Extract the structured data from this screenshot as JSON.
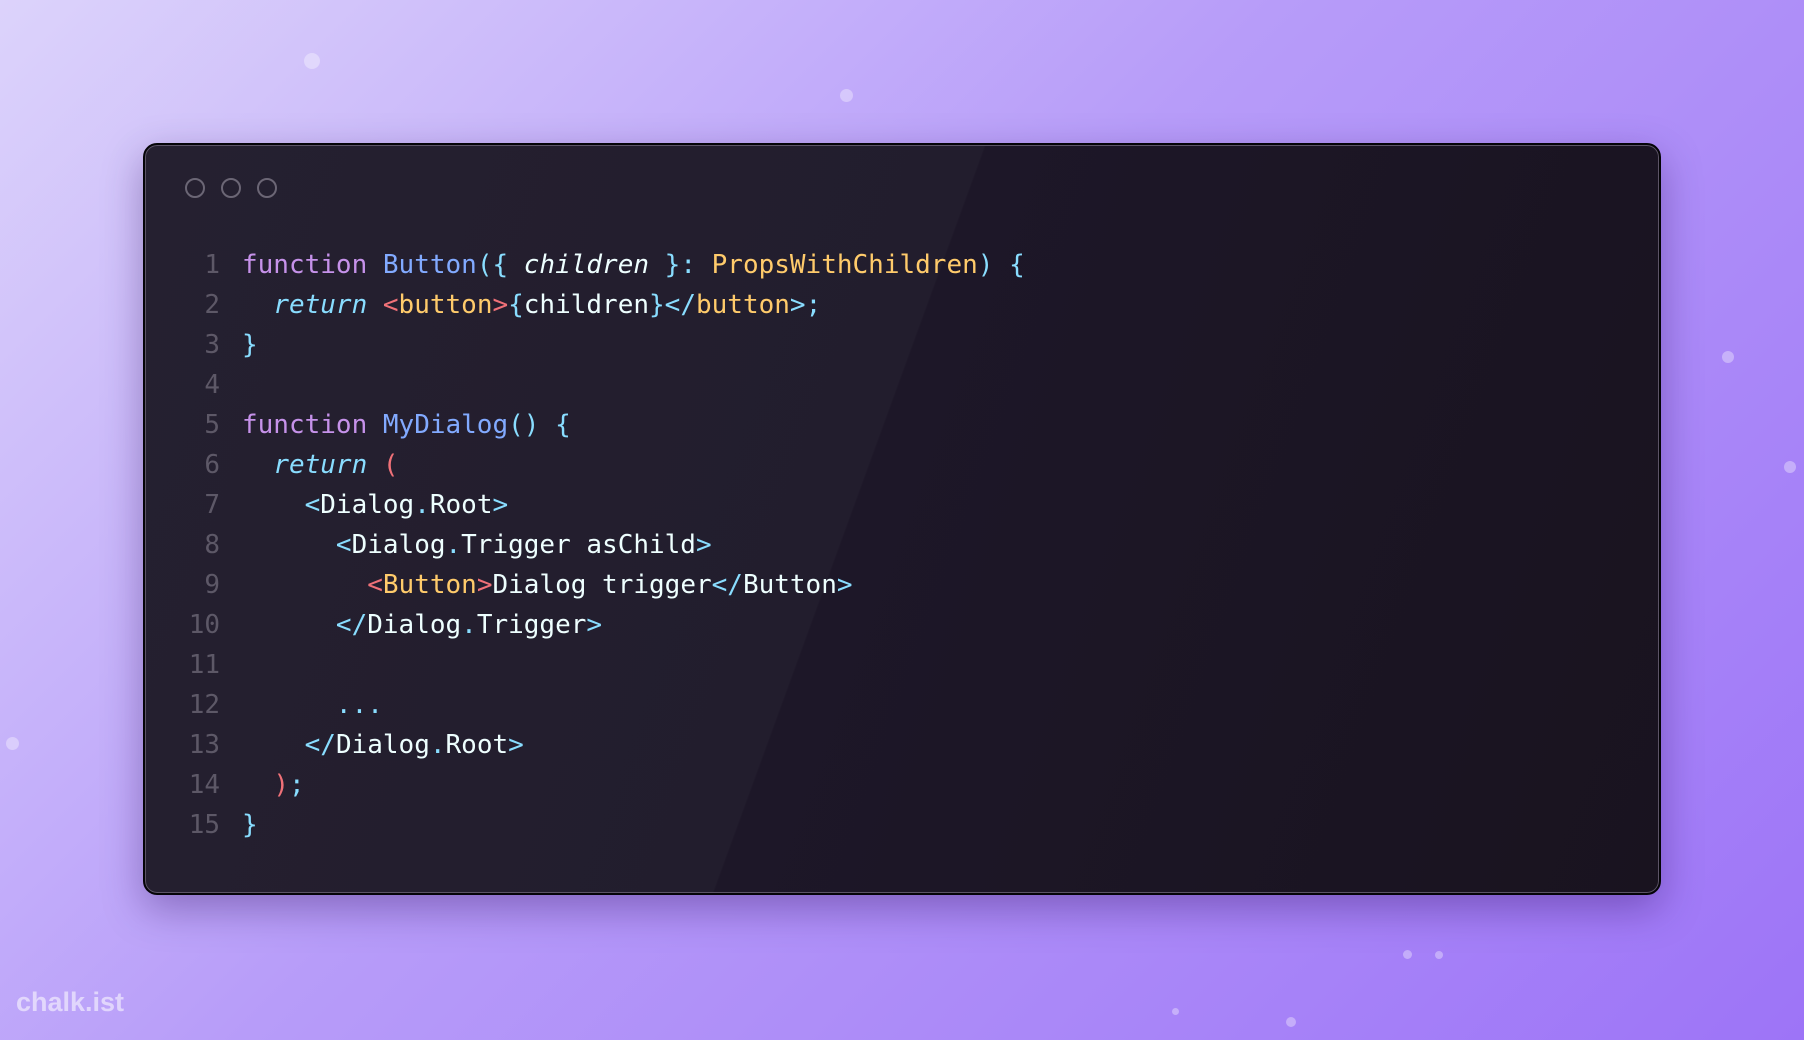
{
  "watermark": "chalk.ist",
  "window": {
    "traffic_lights": [
      "close-light",
      "minimize-light",
      "maximize-light"
    ]
  },
  "code": {
    "language": "tsx",
    "line_numbers": [
      "1",
      "2",
      "3",
      "4",
      "5",
      "6",
      "7",
      "8",
      "9",
      "10",
      "11",
      "12",
      "13",
      "14",
      "15"
    ],
    "lines": [
      "function Button({ children }: PropsWithChildren) {",
      "  return <button>{children}</button>;",
      "}",
      "",
      "function MyDialog() {",
      "  return (",
      "    <Dialog.Root>",
      "      <Dialog.Trigger asChild>",
      "        <Button>Dialog trigger</Button>",
      "      </Dialog.Trigger>",
      "",
      "      ...",
      "    </Dialog.Root>",
      "  );",
      "}"
    ]
  },
  "colors": {
    "keyword": "#c692ea",
    "function": "#82aaff",
    "punctuation": "#89ddff",
    "type": "#ffcb6b",
    "jsx_tag": "#f07178",
    "text": "#eeffff",
    "line_number": "#5d5867",
    "window_bg": "#1d1728"
  }
}
